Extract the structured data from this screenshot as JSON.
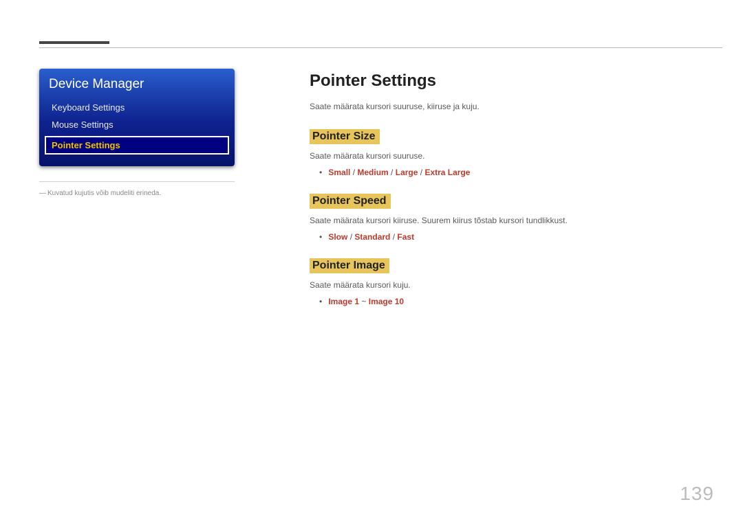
{
  "sidebar": {
    "title": "Device Manager",
    "items": [
      {
        "label": "Keyboard Settings",
        "selected": false
      },
      {
        "label": "Mouse Settings",
        "selected": false
      },
      {
        "label": "Pointer Settings",
        "selected": true
      }
    ],
    "note": "Kuvatud kujutis võib mudeliti erineda."
  },
  "content": {
    "title": "Pointer Settings",
    "intro": "Saate määrata kursori suuruse, kiiruse ja kuju.",
    "sections": [
      {
        "heading": "Pointer Size",
        "desc": "Saate määrata kursori suuruse.",
        "options": [
          "Small",
          "Medium",
          "Large",
          "Extra Large"
        ],
        "separator": " / "
      },
      {
        "heading": "Pointer Speed",
        "desc": "Saate määrata kursori kiiruse. Suurem kiirus tõstab kursori tundlikkust.",
        "options": [
          "Slow",
          "Standard",
          "Fast"
        ],
        "separator": " / "
      },
      {
        "heading": "Pointer Image",
        "desc": "Saate määrata kursori kuju.",
        "options": [
          "Image 1",
          "Image 10"
        ],
        "separator": " ~ "
      }
    ]
  },
  "page_number": "139"
}
